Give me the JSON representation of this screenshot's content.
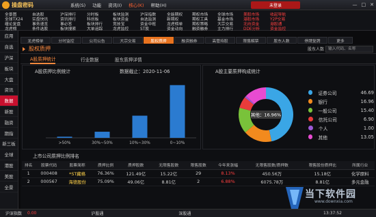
{
  "app": {
    "name": "操盘密码",
    "user_box": "未登录"
  },
  "menu": [
    "系统(S)",
    "功能",
    "资讯(I)",
    "核心(K)",
    "帮助(H)"
  ],
  "menu_highlight_index": 3,
  "toolbar": {
    "row1": [
      "全景图",
      "自选股",
      "沪深排行",
      "分时板",
      "板块监测",
      "沪深指数",
      "全能期权",
      "期权市场",
      "全球市场",
      "美股市场",
      "收起导航"
    ],
    "row2": [
      "全球TX24",
      "实盘快讯",
      "资讯排行",
      "科创板",
      "板块资金",
      "自选监测",
      "新期权",
      "期权工具",
      "基金市场",
      "港股市场",
      "Y2P交易"
    ],
    "row3": [
      "缠论复盘",
      "事务速览",
      "事必答",
      "板块排行",
      "竞技宝",
      "资金中枢",
      "龙虎榜单",
      "期权策略",
      "大宗交易",
      "北向资金",
      "港股通"
    ],
    "row4": [
      "龙虎榜",
      "条件选股",
      "板块搜索",
      "大单追踪",
      "龙虎监控",
      "ST股",
      "资金动向",
      "融资融券",
      "主力排行",
      "DDE分析",
      "资金监控"
    ]
  },
  "sidebar": [
    "应用",
    "自选",
    "沪深",
    "板块",
    "大盘",
    "资讯",
    "数据",
    "新股",
    "融资",
    "期指",
    "新三板",
    "全球",
    "港股",
    "美股",
    "全景"
  ],
  "sidebar_active_index": 6,
  "tabs": [
    "龙虎榜单",
    "分时监控",
    "公司公告",
    "大宗交易",
    "股权质押",
    "融资融券",
    "高管持股",
    "限售解禁",
    "股东人数",
    "停牌复牌",
    "更多"
  ],
  "tabs_active_index": 4,
  "panel": {
    "title": "股权质押",
    "stock_label": "股东人数",
    "search_placeholder": "输入代码、名称",
    "subtabs": [
      "A股质押统计",
      "行业数据",
      "股东质押详情"
    ]
  },
  "left_chart_title": "A股质押比例统计",
  "date_label": "数据截止：2020-11-06",
  "right_chart_title": "A股主要质押构成统计",
  "chart_data": [
    {
      "type": "bar",
      "title": "A股质押比例统计",
      "categories": [
        ">50%",
        "30%~50%",
        "10%~30%",
        "0~10%"
      ],
      "values": [
        30,
        160,
        580,
        1380
      ],
      "ylim": [
        0,
        1500
      ],
      "color": "#2b7bd0"
    },
    {
      "type": "pie",
      "title": "A股主要质押构成统计",
      "labels": [
        "证券公司",
        "银行",
        "一般公司",
        "信托公司",
        "个人",
        "其他"
      ],
      "values": [
        46.69,
        16.96,
        15.4,
        6.9,
        1.0,
        13.05
      ],
      "colors": [
        "#3aa6e6",
        "#f28a1e",
        "#79c23a",
        "#ea3b3b",
        "#9b59d6",
        "#e84bd1"
      ],
      "center_label": "其他：16.96%"
    }
  ],
  "legend_values": [
    "46.69",
    "16.96",
    "15.40",
    "6.90",
    "1.00",
    "13.05"
  ],
  "table": {
    "title": "上市公司质押比例排名",
    "headers": [
      "排名",
      "股票代码",
      "股票简称",
      "质押比例",
      "质押股数",
      "无限售股数",
      "限售股数",
      "今年来涨幅",
      "无限售股数/质押数",
      "限售股份质押比",
      "所属行业"
    ],
    "rows": [
      [
        "1",
        "000408",
        "*ST藏格",
        "76.36%",
        "121.49亿",
        "15.22亿",
        "29",
        "8.13%",
        "450.56万",
        "15.18亿",
        "化学原料"
      ],
      [
        "2",
        "000567",
        "海德股份",
        "75.09%",
        "49.06亿",
        "8.81亿",
        "2",
        "6.88%",
        "6075.78万",
        "8.81亿",
        "多元金融"
      ]
    ]
  },
  "statusbar": [
    "沪深指数",
    "0.00",
    "沪股通",
    "深股通",
    "13:37:52"
  ],
  "watermark": {
    "brand": "当下软件园",
    "url": "www.downxia.com"
  }
}
